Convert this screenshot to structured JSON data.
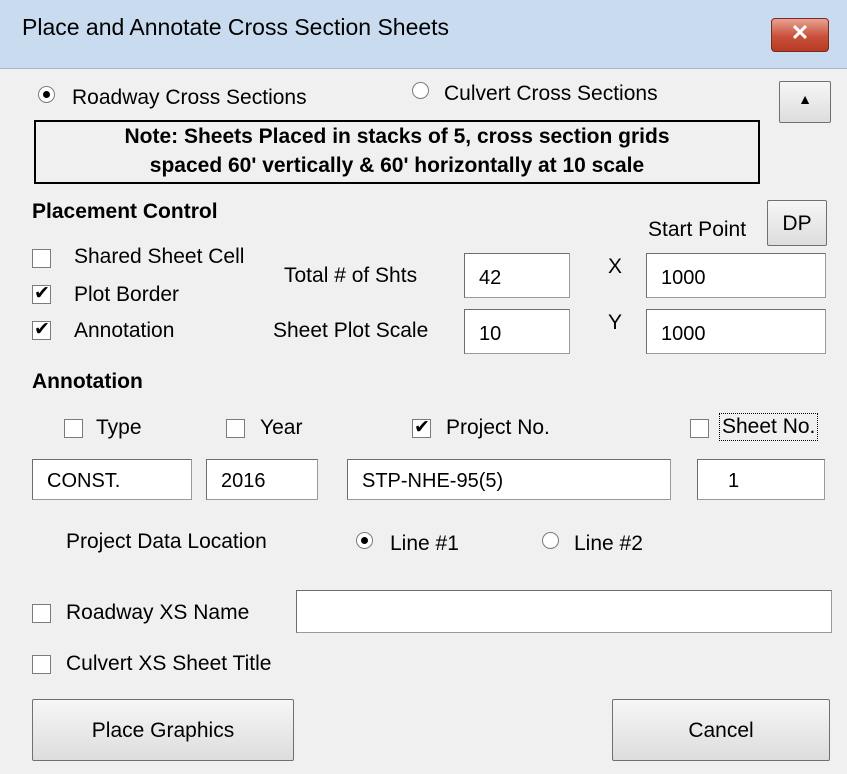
{
  "window": {
    "title": "Place and Annotate Cross Section Sheets",
    "close_label": "✕"
  },
  "section_type": {
    "roadway_label": "Roadway Cross Sections",
    "roadway_selected": true,
    "culvert_label": "Culvert Cross Sections",
    "culvert_selected": false,
    "collapse_label": "▲"
  },
  "note": {
    "line1": "Note: Sheets Placed in stacks of 5, cross section grids",
    "line2": "spaced 60' vertically & 60' horizontally at 10 scale"
  },
  "placement": {
    "heading": "Placement Control",
    "shared_sheet_cell_label": "Shared Sheet Cell",
    "shared_sheet_cell_checked": false,
    "plot_border_label": "Plot Border",
    "plot_border_checked": true,
    "annotation_label": "Annotation",
    "annotation_checked": true,
    "total_sheets_label": "Total # of Shts",
    "total_sheets_value": "42",
    "plot_scale_label": "Sheet Plot Scale",
    "plot_scale_value": "10",
    "start_point_label": "Start Point",
    "dp_button_label": "DP",
    "x_label": "X",
    "x_value": "1000",
    "y_label": "Y",
    "y_value": "1000"
  },
  "annotation": {
    "heading": "Annotation",
    "type_label": "Type",
    "type_checked": false,
    "type_value": "CONST.",
    "year_label": "Year",
    "year_checked": false,
    "year_value": "2016",
    "project_label": "Project No.",
    "project_checked": true,
    "project_value": "STP-NHE-95(5)",
    "sheet_label": "Sheet No.",
    "sheet_checked": false,
    "sheet_value": "1",
    "location_label": "Project Data Location",
    "line1_label": "Line #1",
    "line1_selected": true,
    "line2_label": "Line #2",
    "line2_selected": false
  },
  "roadway_xs_name": {
    "label": "Roadway XS Name",
    "checked": false,
    "value": ""
  },
  "culvert_xs_title": {
    "label": "Culvert XS Sheet Title",
    "checked": false
  },
  "buttons": {
    "place_graphics": "Place Graphics",
    "cancel": "Cancel"
  }
}
